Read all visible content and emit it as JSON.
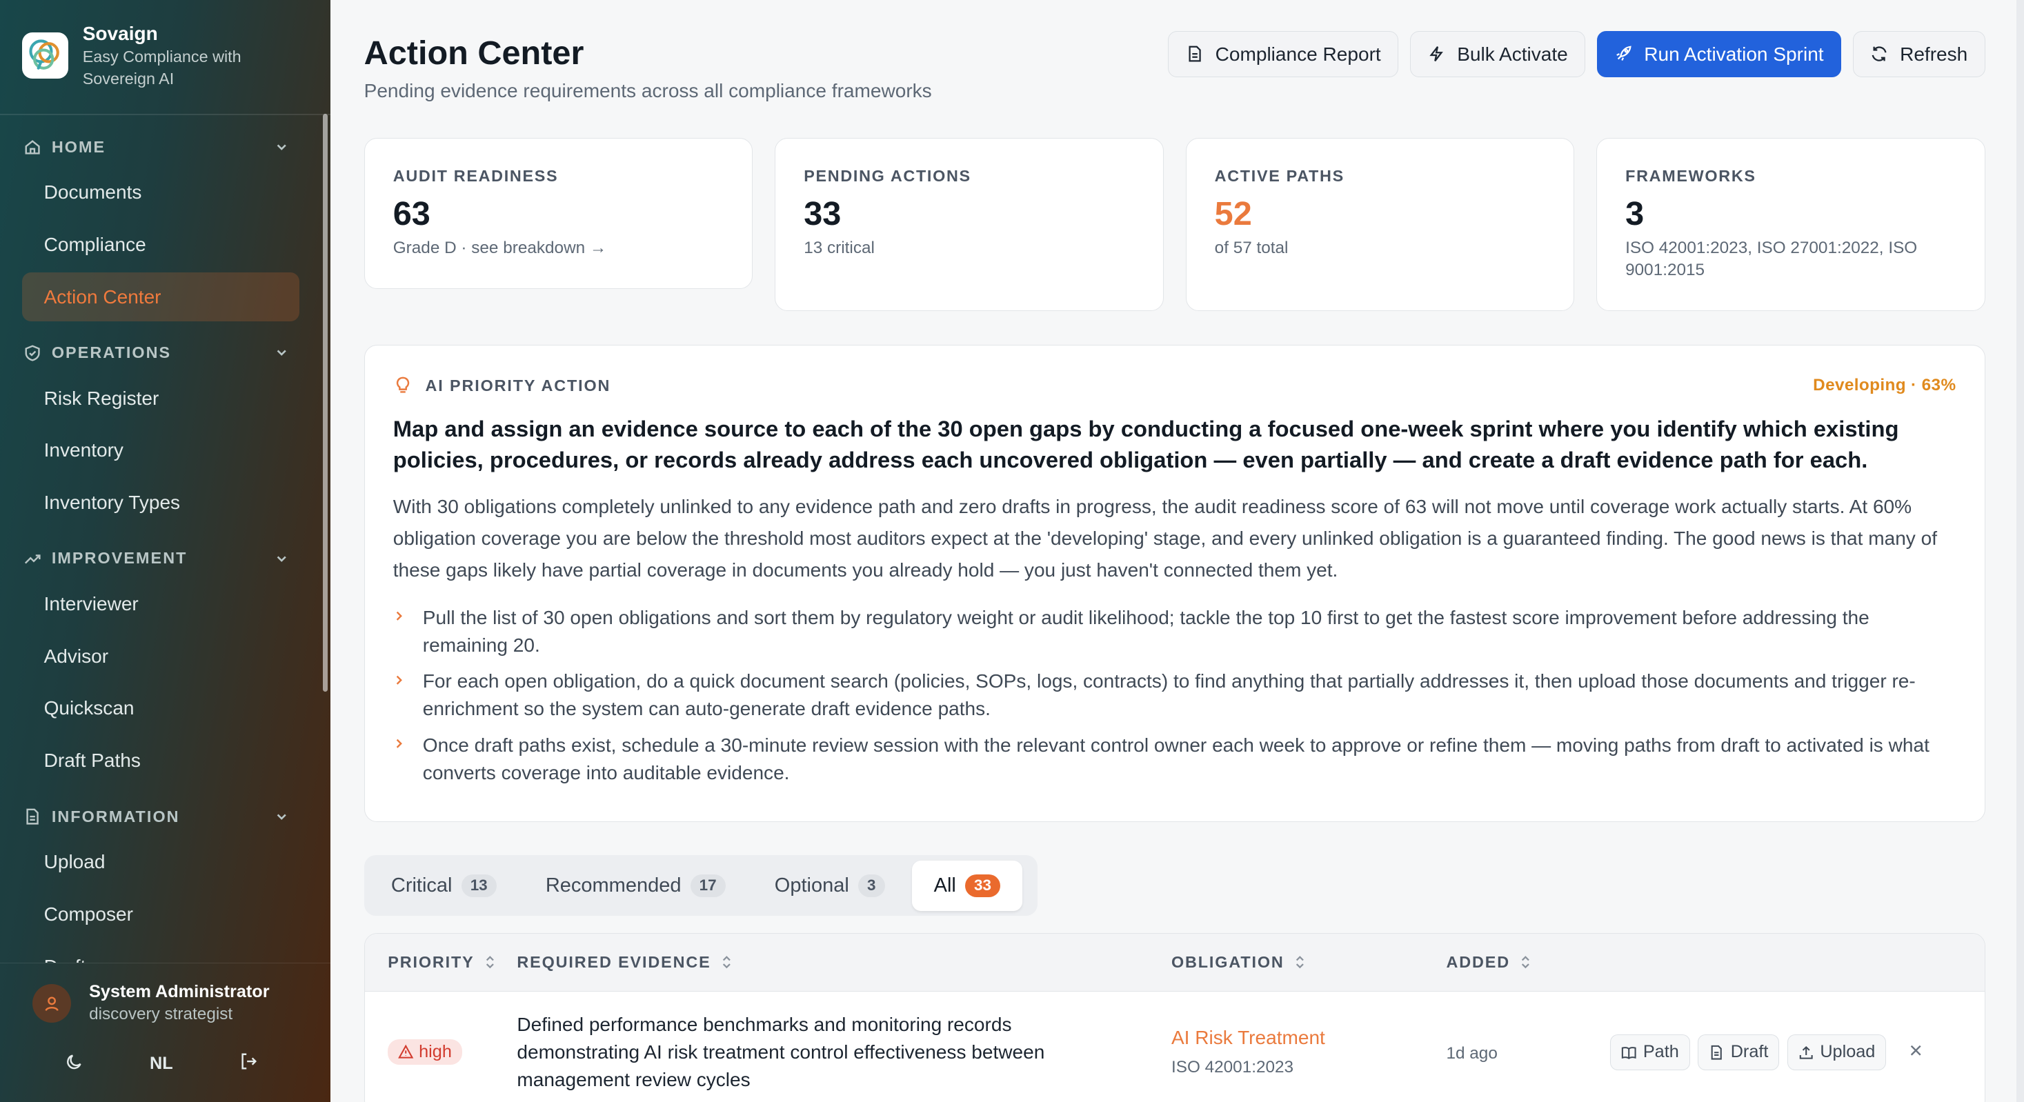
{
  "brand": {
    "name": "Sovaign",
    "tagline_line1": "Easy Compliance with",
    "tagline_line2": "Sovereign AI"
  },
  "sidebar": {
    "sections": [
      {
        "label": "HOME",
        "icon": "home-icon",
        "items": [
          {
            "label": "Documents"
          },
          {
            "label": "Compliance"
          },
          {
            "label": "Action Center",
            "active": true
          }
        ]
      },
      {
        "label": "OPERATIONS",
        "icon": "shield-check-icon",
        "items": [
          {
            "label": "Risk Register"
          },
          {
            "label": "Inventory"
          },
          {
            "label": "Inventory Types"
          }
        ]
      },
      {
        "label": "IMPROVEMENT",
        "icon": "trend-up-icon",
        "items": [
          {
            "label": "Interviewer"
          },
          {
            "label": "Advisor"
          },
          {
            "label": "Quickscan"
          },
          {
            "label": "Draft Paths"
          }
        ]
      },
      {
        "label": "INFORMATION",
        "icon": "document-icon",
        "items": [
          {
            "label": "Upload"
          },
          {
            "label": "Composer"
          },
          {
            "label": "Drafts"
          }
        ]
      }
    ],
    "user": {
      "name": "System Administrator",
      "role": "discovery strategist",
      "language": "NL"
    }
  },
  "header": {
    "title": "Action Center",
    "subtitle": "Pending evidence requirements across all compliance frameworks",
    "buttons": {
      "report": "Compliance Report",
      "bulk": "Bulk Activate",
      "sprint": "Run Activation Sprint",
      "refresh": "Refresh"
    }
  },
  "stats": [
    {
      "label": "AUDIT READINESS",
      "value": "63",
      "note": "Grade D · see breakdown →"
    },
    {
      "label": "PENDING ACTIONS",
      "value": "33",
      "note": "13 critical"
    },
    {
      "label": "ACTIVE PATHS",
      "value": "52",
      "note": "of 57 total"
    },
    {
      "label": "FRAMEWORKS",
      "value": "3",
      "note": "ISO 42001:2023, ISO 27001:2022, ISO 9001:2015"
    }
  ],
  "ai": {
    "label": "AI PRIORITY ACTION",
    "status": "Developing · 63%",
    "title": "Map and assign an evidence source to each of the 30 open gaps by conducting a focused one-week sprint where you identify which existing policies, procedures, or records already address each uncovered obligation — even partially — and create a draft evidence path for each.",
    "body": "With 30 obligations completely unlinked to any evidence path and zero drafts in progress, the audit readiness score of 63 will not move until coverage work actually starts. At 60% obligation coverage you are below the threshold most auditors expect at the 'developing' stage, and every unlinked obligation is a guaranteed finding. The good news is that many of these gaps likely have partial coverage in documents you already hold — you just haven't connected them yet.",
    "steps": [
      "Pull the list of 30 open obligations and sort them by regulatory weight or audit likelihood; tackle the top 10 first to get the fastest score improvement before addressing the remaining 20.",
      "For each open obligation, do a quick document search (policies, SOPs, logs, contracts) to find anything that partially addresses it, then upload those documents and trigger re-enrichment so the system can auto-generate draft evidence paths.",
      "Once draft paths exist, schedule a 30-minute review session with the relevant control owner each week to approve or refine them — moving paths from draft to activated is what converts coverage into auditable evidence."
    ]
  },
  "tabs": [
    {
      "label": "Critical",
      "count": "13"
    },
    {
      "label": "Recommended",
      "count": "17"
    },
    {
      "label": "Optional",
      "count": "3"
    },
    {
      "label": "All",
      "count": "33",
      "active": true
    }
  ],
  "table": {
    "headers": {
      "priority": "PRIORITY",
      "evidence": "REQUIRED EVIDENCE",
      "obligation": "OBLIGATION",
      "added": "ADDED"
    },
    "rows": [
      {
        "priority": "high",
        "evidence": "Defined performance benchmarks and monitoring records demonstrating AI risk treatment control effectiveness between management review cycles",
        "obligation": "AI Risk Treatment",
        "framework": "ISO 42001:2023",
        "added": "1d ago",
        "actions": {
          "path": "Path",
          "draft": "Draft",
          "upload": "Upload"
        }
      }
    ]
  },
  "colors": {
    "accent_orange": "#ea7a3d",
    "primary_blue": "#2262dc",
    "danger_red": "#d23b2e"
  }
}
